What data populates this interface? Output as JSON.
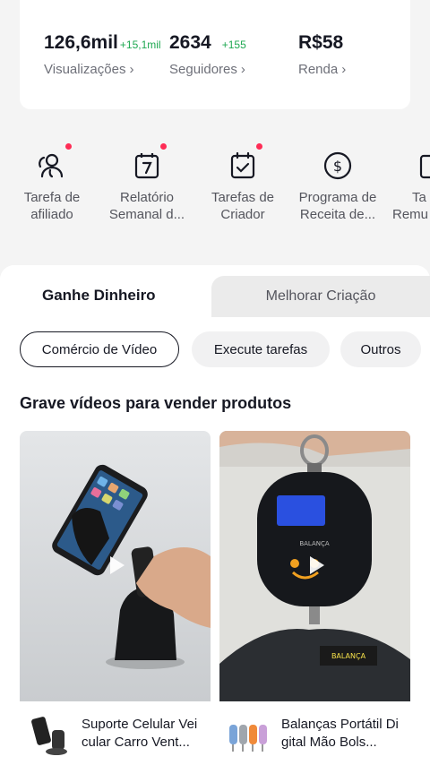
{
  "stats": [
    {
      "value": "126,6mil",
      "delta": "+15,1mil",
      "label": "Visualizações"
    },
    {
      "value": "2634",
      "delta": "+155",
      "label": "Seguidores"
    },
    {
      "value": "R$58",
      "delta": "",
      "label": "Renda"
    }
  ],
  "shortcuts": [
    {
      "line1": "Tarefa de",
      "line2": "afiliado",
      "icon": "affiliate-users-icon",
      "badge": true
    },
    {
      "line1": "Relatório",
      "line2": "Semanal d...",
      "icon": "calendar-7-icon",
      "badge": true
    },
    {
      "line1": "Tarefas de",
      "line2": "Criador",
      "icon": "calendar-check-icon",
      "badge": true
    },
    {
      "line1": "Programa de",
      "line2": "Receita de...",
      "icon": "dollar-coin-icon",
      "badge": false
    },
    {
      "line1": "Ta",
      "line2": "Remu",
      "icon": "partial-item-icon",
      "badge": false
    }
  ],
  "tabs": {
    "active": "Ganhe Dinheiro",
    "inactive": "Melhorar Criação"
  },
  "chips": [
    "Comércio de Vídeo",
    "Execute tarefas",
    "Outros"
  ],
  "section_title": "Grave vídeos para vender produtos",
  "products": [
    {
      "name": "Suporte Celular Veicular Carro Vent..."
    },
    {
      "name": "Balanças Portátil Digital Mão Bols..."
    }
  ],
  "colors": {
    "accent": "#fe2c55",
    "positive": "#1ea851",
    "text": "#161823",
    "muted": "#6e7079"
  }
}
